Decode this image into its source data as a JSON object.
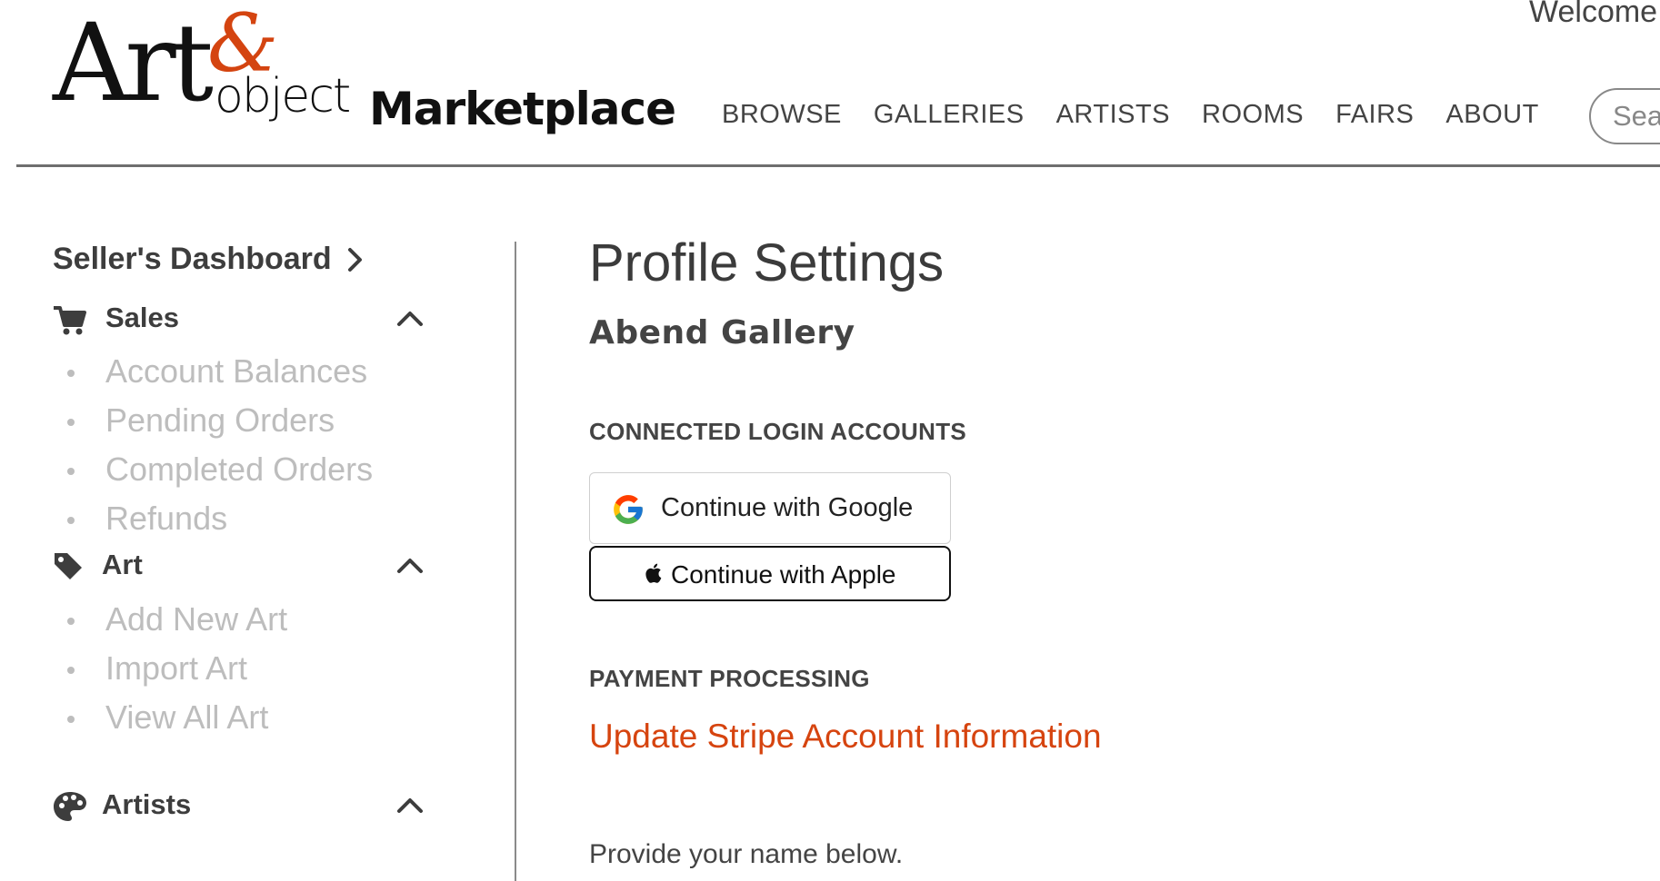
{
  "header": {
    "logo": {
      "art": "Art",
      "amp": "&",
      "object": "object",
      "marketplace": "Marketplace"
    },
    "nav": [
      "BROWSE",
      "GALLERIES",
      "ARTISTS",
      "ROOMS",
      "FAIRS",
      "ABOUT"
    ],
    "welcome": "Welcome",
    "search_placeholder": "Search"
  },
  "sidebar": {
    "dashboard_link": "Seller's Dashboard",
    "sections": [
      {
        "title": "Sales",
        "icon": "cart-icon",
        "items": [
          "Account Balances",
          "Pending Orders",
          "Completed Orders",
          "Refunds"
        ]
      },
      {
        "title": "Art",
        "icon": "tag-icon",
        "items": [
          "Add New Art",
          "Import Art",
          "View All Art"
        ]
      },
      {
        "title": "Artists",
        "icon": "palette-icon",
        "items": []
      }
    ]
  },
  "main": {
    "title": "Profile Settings",
    "gallery_name": "Abend Gallery",
    "connected_label": "CONNECTED LOGIN ACCOUNTS",
    "google_button": "Continue with Google",
    "apple_button": "Continue with Apple",
    "payment_label": "PAYMENT PROCESSING",
    "stripe_link": "Update Stripe Account Information",
    "provide_text": "Provide your name below."
  },
  "colors": {
    "accent": "#d6440f",
    "text": "#3b3b3b",
    "muted": "#bdbdbd",
    "rule": "#6e6e6e"
  }
}
